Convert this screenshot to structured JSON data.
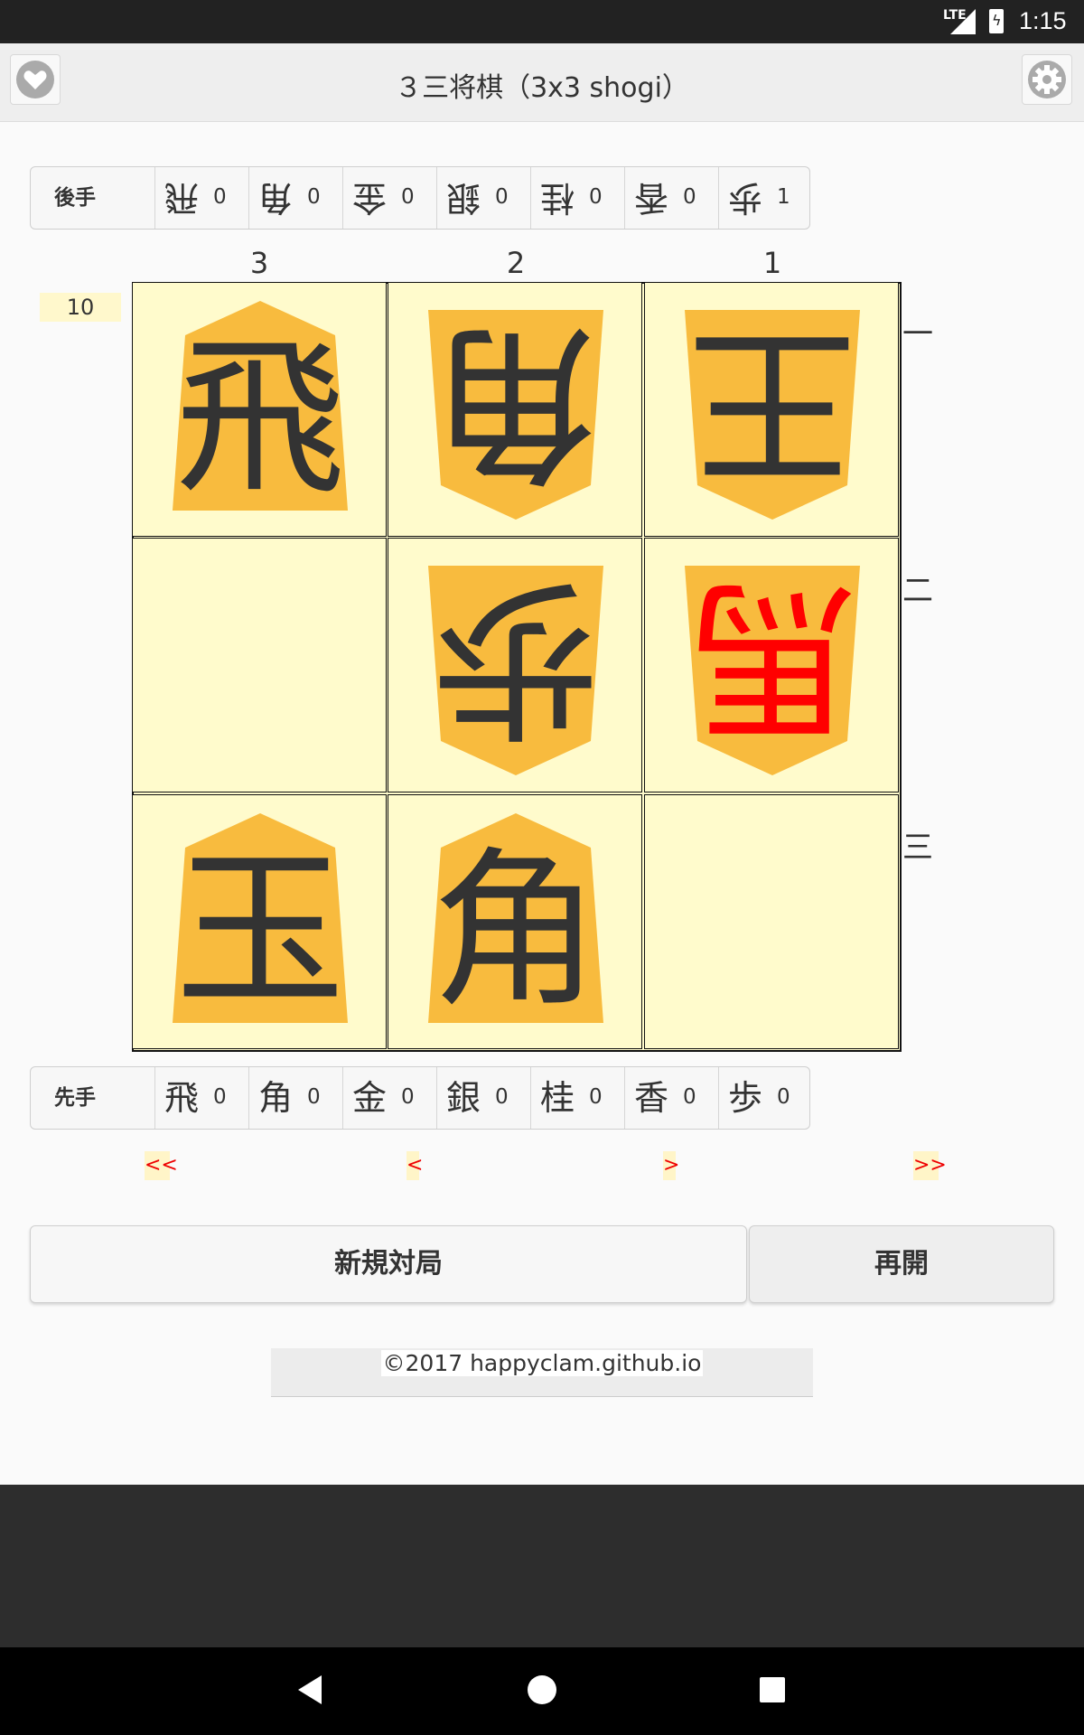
{
  "status_bar": {
    "network": "LTE",
    "time": "1:15"
  },
  "app": {
    "title": "３三将棋（3x3 shogi）",
    "favorite_icon": "heart-icon",
    "settings_icon": "gear-icon"
  },
  "gote_hand": {
    "label": "後手",
    "pieces": [
      {
        "kanji": "飛",
        "count": "0"
      },
      {
        "kanji": "角",
        "count": "0"
      },
      {
        "kanji": "金",
        "count": "0"
      },
      {
        "kanji": "銀",
        "count": "0"
      },
      {
        "kanji": "桂",
        "count": "0"
      },
      {
        "kanji": "香",
        "count": "0"
      },
      {
        "kanji": "歩",
        "count": "1"
      }
    ]
  },
  "board": {
    "move_number": "10",
    "columns": [
      "3",
      "2",
      "1"
    ],
    "rows": [
      "一",
      "二",
      "三"
    ],
    "squares": [
      {
        "row": 0,
        "col": 0,
        "piece": "飛",
        "owner": "sente",
        "promoted": false
      },
      {
        "row": 0,
        "col": 1,
        "piece": "角",
        "owner": "gote",
        "promoted": false
      },
      {
        "row": 0,
        "col": 2,
        "piece": "王",
        "owner": "gote",
        "promoted": false
      },
      {
        "row": 1,
        "col": 0,
        "piece": "",
        "owner": "",
        "promoted": false
      },
      {
        "row": 1,
        "col": 1,
        "piece": "歩",
        "owner": "gote",
        "promoted": false
      },
      {
        "row": 1,
        "col": 2,
        "piece": "馬",
        "owner": "gote",
        "promoted": true
      },
      {
        "row": 2,
        "col": 0,
        "piece": "玉",
        "owner": "sente",
        "promoted": false
      },
      {
        "row": 2,
        "col": 1,
        "piece": "角",
        "owner": "sente",
        "promoted": false
      },
      {
        "row": 2,
        "col": 2,
        "piece": "",
        "owner": "",
        "promoted": false
      }
    ],
    "piece_color": "#f8bb3e",
    "text_color": "#333333",
    "promoted_color": "#ff0000",
    "square_color": "#fffbcc"
  },
  "sente_hand": {
    "label": "先手",
    "pieces": [
      {
        "kanji": "飛",
        "count": "0"
      },
      {
        "kanji": "角",
        "count": "0"
      },
      {
        "kanji": "金",
        "count": "0"
      },
      {
        "kanji": "銀",
        "count": "0"
      },
      {
        "kanji": "桂",
        "count": "0"
      },
      {
        "kanji": "香",
        "count": "0"
      },
      {
        "kanji": "歩",
        "count": "0"
      }
    ]
  },
  "navigation": {
    "first": "<<",
    "prev": "<",
    "next": ">",
    "last": ">>"
  },
  "buttons": {
    "new_game": "新規対局",
    "resume": "再開"
  },
  "footer": {
    "copyright": "©2017 happyclam.github.io"
  }
}
